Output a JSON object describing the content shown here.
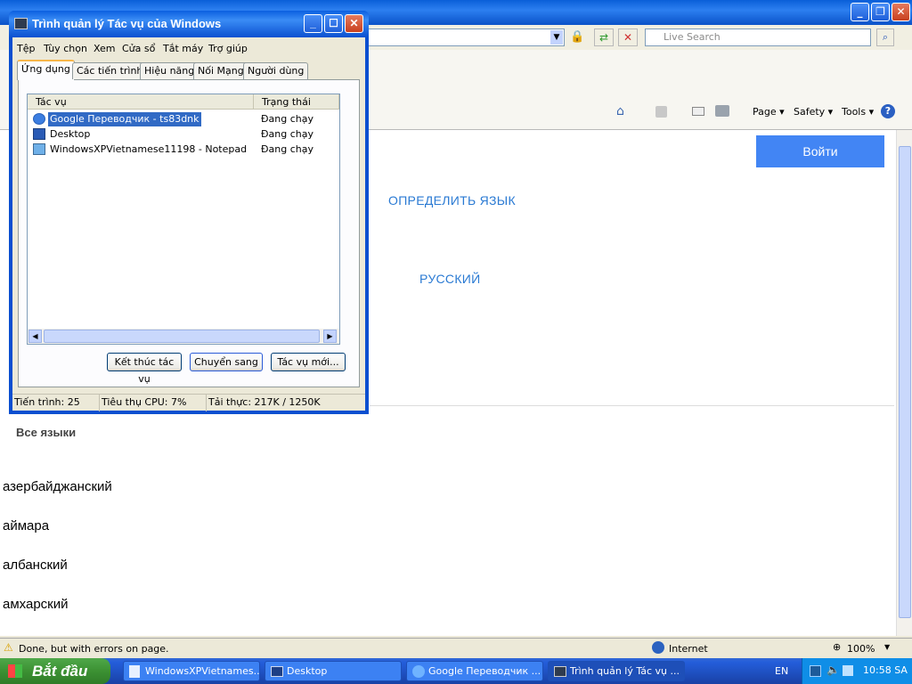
{
  "ie": {
    "search_placeholder": "Live Search",
    "commands": {
      "page": "Page ▾",
      "safety": "Safety ▾",
      "tools": "Tools ▾"
    },
    "login_button": "Войти",
    "detect_language": "ОПРЕДЕЛИТЬ ЯЗЫК",
    "russian": "РУССКИЙ",
    "all_languages": "Все языки",
    "languages": [
      "азербайджанский",
      "аймара",
      "албанский",
      "амхарский"
    ],
    "status_text": "Done, but with errors on page.",
    "zone": "Internet",
    "zoom": "100%"
  },
  "task_manager": {
    "title": "Trình quản lý Tác vụ của Windows",
    "menu": [
      "Tệp",
      "Tùy chọn",
      "Xem",
      "Cửa sổ",
      "Tắt máy",
      "Trợ giúp"
    ],
    "tabs": [
      "Ứng dụng",
      "Các tiến trình",
      "Hiệu năng",
      "Nối Mạng",
      "Người dùng"
    ],
    "columns": {
      "task": "Tác vụ",
      "status": "Trạng thái"
    },
    "rows": [
      {
        "name": "Google Переводчик - ts83dnk",
        "status": "Đang chạy"
      },
      {
        "name": "Desktop",
        "status": "Đang chạy"
      },
      {
        "name": "WindowsXPVietnamese11198 - Notepad",
        "status": "Đang chạy"
      }
    ],
    "buttons": {
      "end_task": "Kết thúc tác vụ",
      "switch_to": "Chuyển sang",
      "new_task": "Tác vụ mới..."
    },
    "status": {
      "processes": "Tiến trình: 25",
      "cpu": "Tiêu thụ CPU: 7%",
      "commit": "Tải thực: 217K / 1250K"
    }
  },
  "taskbar": {
    "start": "Bắt đầu",
    "buttons": [
      "WindowsXPVietnames...",
      "Desktop",
      "Google Переводчик ...",
      "Trình quản lý Tác vụ ..."
    ],
    "lang": "EN",
    "clock": "10:58 SA"
  }
}
